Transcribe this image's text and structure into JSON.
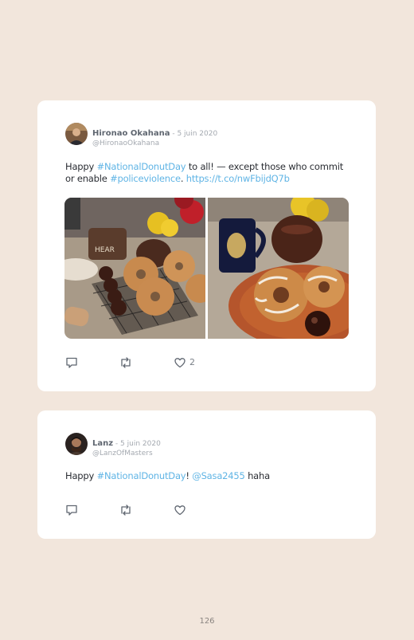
{
  "tweets": [
    {
      "author_name": "Hironao Okahana",
      "separator": " - ",
      "date": "5 juin 2020",
      "handle": "@HironaoOkahana",
      "text_parts": [
        {
          "text": "Happy ",
          "type": "plain"
        },
        {
          "text": "#NationalDonutDay",
          "type": "hashtag"
        },
        {
          "text": " to all! — except those who commit or enable ",
          "type": "plain"
        },
        {
          "text": "#policeviolence",
          "type": "hashtag"
        },
        {
          "text": ". ",
          "type": "plain"
        },
        {
          "text": "https://t.co/nwFbijdQ7b",
          "type": "link"
        }
      ],
      "photos": [
        "donuts-on-cooling-rack",
        "donuts-on-plate-with-mug"
      ],
      "actions": {
        "reply_icon": "reply-icon",
        "retweet_icon": "retweet-icon",
        "like_icon": "heart-icon",
        "like_count": "2"
      }
    },
    {
      "author_name": "Lanz",
      "separator": " - ",
      "date": "5 juin 2020",
      "handle": "@LanzOfMasters",
      "text_parts": [
        {
          "text": "Happy ",
          "type": "plain"
        },
        {
          "text": "#NationalDonutDay",
          "type": "hashtag"
        },
        {
          "text": "! ",
          "type": "plain"
        },
        {
          "text": "@Sasa2455",
          "type": "mention"
        },
        {
          "text": " haha",
          "type": "plain"
        }
      ],
      "actions": {
        "reply_icon": "reply-icon",
        "retweet_icon": "retweet-icon",
        "like_icon": "heart-icon",
        "like_count": ""
      }
    }
  ],
  "page_number": "126",
  "colors": {
    "background": "#f2e6dc",
    "card": "#ffffff",
    "link": "#5fb4e5",
    "muted": "#a4a9b0"
  }
}
